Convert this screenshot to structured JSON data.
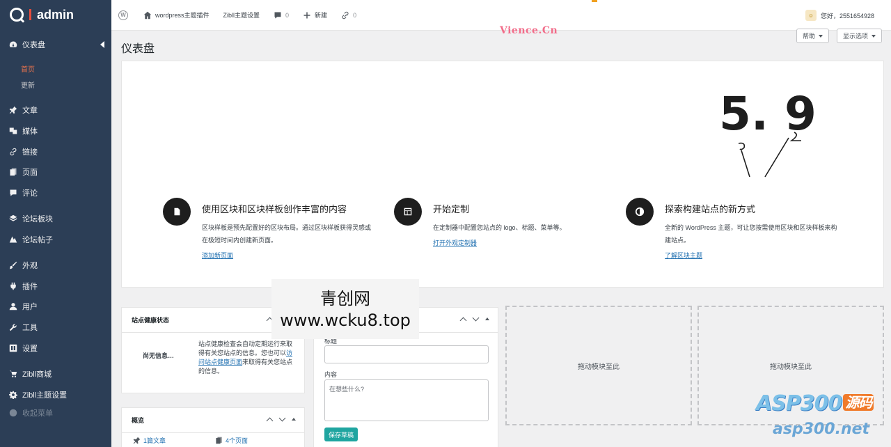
{
  "brand": {
    "name": "admin"
  },
  "sidebar": {
    "items": [
      {
        "label": "仪表盘",
        "icon": "dashboard-icon"
      },
      {
        "label": "文章",
        "icon": "pin-icon"
      },
      {
        "label": "媒体",
        "icon": "media-icon"
      },
      {
        "label": "链接",
        "icon": "link-icon"
      },
      {
        "label": "页面",
        "icon": "page-icon"
      },
      {
        "label": "评论",
        "icon": "comment-icon"
      },
      {
        "label": "论坛板块",
        "icon": "forum-icon"
      },
      {
        "label": "论坛帖子",
        "icon": "post-icon"
      },
      {
        "label": "外观",
        "icon": "appearance-icon"
      },
      {
        "label": "插件",
        "icon": "plugin-icon"
      },
      {
        "label": "用户",
        "icon": "user-icon"
      },
      {
        "label": "工具",
        "icon": "tool-icon"
      },
      {
        "label": "设置",
        "icon": "settings-icon"
      },
      {
        "label": "Zibll商城",
        "icon": "cart-icon"
      },
      {
        "label": "Zibll主题设置",
        "icon": "gear-icon"
      },
      {
        "label": "收起菜单",
        "icon": "collapse-icon"
      }
    ],
    "sub": {
      "home": "首页",
      "updates": "更新"
    }
  },
  "topbar": {
    "items": [
      {
        "label": "wordpress主题插件",
        "icon": "home-icon"
      },
      {
        "label": "Zibll主题设置"
      },
      {
        "label": "0",
        "icon": "comment-icon"
      },
      {
        "label": "新建",
        "icon": "plus-icon"
      },
      {
        "label": "0",
        "icon": "link-icon"
      }
    ],
    "user": "您好，2551654928"
  },
  "header": {
    "title": "仪表盘",
    "help": "帮助",
    "screen_options": "显示选项",
    "watermark": "Vience.Cn"
  },
  "welcome": {
    "version_text": "5. 9",
    "columns": [
      {
        "title": "使用区块和区块样板创作丰富的内容",
        "text": "区块样板是预先配置好的区块布局。通过区块样板获得灵感或在极短时间内创建新页面。",
        "link": "添加新页面"
      },
      {
        "title": "开始定制",
        "text": "在定制器中配置您站点的 logo、标题、菜单等。",
        "link": "打开外观定制器"
      },
      {
        "title": "探索构建站点的新方式",
        "text": "全新的 WordPress 主题，可让您按需使用区块和区块样板来构建站点。",
        "link": "了解区块主题"
      }
    ]
  },
  "health": {
    "title": "站点健康状态",
    "no_info": "尚无信息…",
    "desc_before": "站点健康检查会自动定期运行来取得有关您站点的信息。您也可以",
    "desc_link": "访问站点健康页面",
    "desc_after": "来取得有关您站点的信息。"
  },
  "overview": {
    "title": "概览",
    "posts": "1篇文章",
    "pages": "4个页面"
  },
  "draft": {
    "title_label": "标题",
    "content_label": "内容",
    "content_placeholder": "在想些什么?",
    "save": "保存草稿"
  },
  "dropzone": {
    "label": "拖动模块至此"
  },
  "overlay": {
    "line1": "青创网",
    "line2": "www.wcku8.top"
  },
  "watermark2": {
    "main": "ASP300",
    "badge": "源码",
    "domain": "asp300.net"
  },
  "colors": {
    "sidebar": "#2c3e56",
    "accent": "#1fa5a0",
    "link": "#2271b1",
    "current": "#e8734d"
  }
}
